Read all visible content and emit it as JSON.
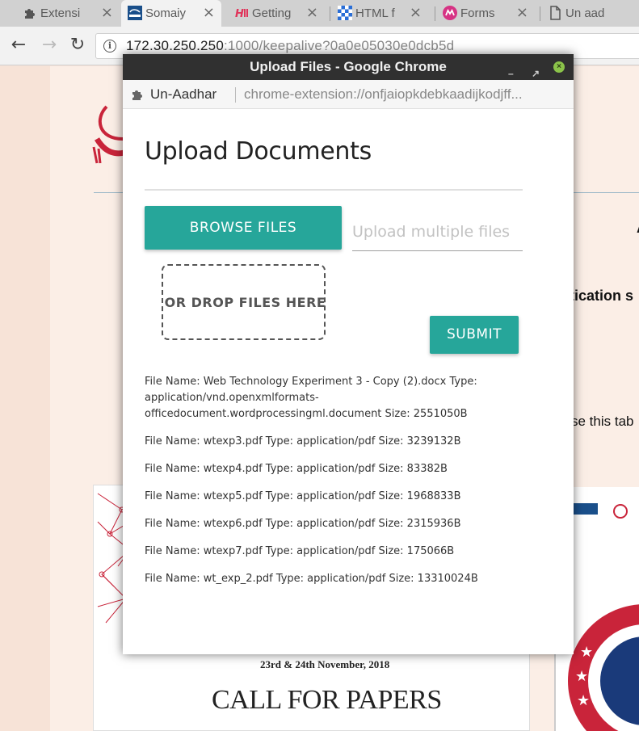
{
  "browser": {
    "tabs": [
      {
        "label": "Extensi",
        "icon": "puzzle-icon",
        "active": false
      },
      {
        "label": "Somaiy",
        "icon": "somaiya-favicon",
        "active": true
      },
      {
        "label": "Getting",
        "icon": "hackerrank-favicon",
        "active": false
      },
      {
        "label": "HTML f",
        "icon": "checker-favicon",
        "active": false
      },
      {
        "label": "Forms",
        "icon": "forms-favicon",
        "active": false
      },
      {
        "label": "Un aad",
        "icon": "page-icon",
        "active": false
      }
    ],
    "tab_close_glyph": "×",
    "address": {
      "host": "172.30.250.250",
      "rest": ":1000/keepalive?0a0e05030e0dcb5d"
    }
  },
  "background_page": {
    "fragment_top": "A",
    "fragment_application": "tication s",
    "fragment_mid": "se this tab",
    "poster_date": "23rd & 24th November, 2018",
    "poster_title": "CALL FOR PAPERS"
  },
  "popup": {
    "window_title": "Upload Files - Google Chrome",
    "ext_name": "Un-Aadhar",
    "ext_url": "chrome-extension://onfjaiopkdebkaadijkodjff...",
    "heading": "Upload Documents",
    "browse_label": "BROWSE FILES",
    "path_placeholder": "Upload multiple files",
    "drop_label": "OR DROP FILES HERE",
    "submit_label": "SUBMIT",
    "files": [
      "File Name: Web Technology Experiment 3 - Copy (2).docx Type: application/vnd.openxmlformats-officedocument.wordprocessingml.document Size: 2551050B",
      "File Name: wtexp3.pdf Type: application/pdf Size: 3239132B",
      "File Name: wtexp4.pdf Type: application/pdf Size: 83382B",
      "File Name: wtexp5.pdf Type: application/pdf Size: 1968833B",
      "File Name: wtexp6.pdf Type: application/pdf Size: 2315936B",
      "File Name: wtexp7.pdf Type: application/pdf Size: 175066B",
      "File Name: wt_exp_2.pdf Type: application/pdf Size: 13310024B"
    ]
  },
  "colors": {
    "accent": "#26a69a",
    "titlebar": "#303030",
    "close_button": "#8bc34a"
  }
}
